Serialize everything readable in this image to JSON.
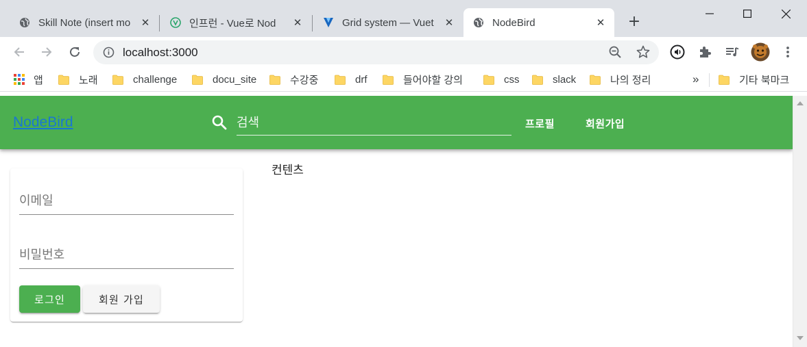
{
  "browser": {
    "tabs": [
      {
        "title": "Skill Note (insert mo",
        "favicon": "globe-icon",
        "active": false
      },
      {
        "title": "인프런 - Vue로 Nod",
        "favicon": "inflearn-icon",
        "active": false
      },
      {
        "title": "Grid system — Vuet",
        "favicon": "vuetify-icon",
        "active": false
      },
      {
        "title": "NodeBird",
        "favicon": "globe-icon",
        "active": true
      }
    ],
    "new_tab_label": "+",
    "address": "localhost:3000",
    "bookmarks": {
      "apps_label": "앱",
      "folders": [
        "노래",
        "challenge",
        "docu_site",
        "수강중",
        "drf",
        "들어야할 강의",
        "css",
        "slack",
        "나의 정리"
      ],
      "overflow_label": "»",
      "other_label": "기타 북마크"
    },
    "colors": {
      "tabstrip": "#dee1e6",
      "folder": "#fdd663"
    }
  },
  "app": {
    "brand": "NodeBird",
    "search_placeholder": "검색",
    "nav": {
      "profile": "프로필",
      "signup": "회원가입"
    },
    "login": {
      "email_placeholder": "이메일",
      "password_placeholder": "비밀번호",
      "login_button": "로그인",
      "signup_button": "회원 가입"
    },
    "content_label": "컨텐츠",
    "colors": {
      "primary": "#4caf50",
      "link": "#1976d2"
    }
  }
}
